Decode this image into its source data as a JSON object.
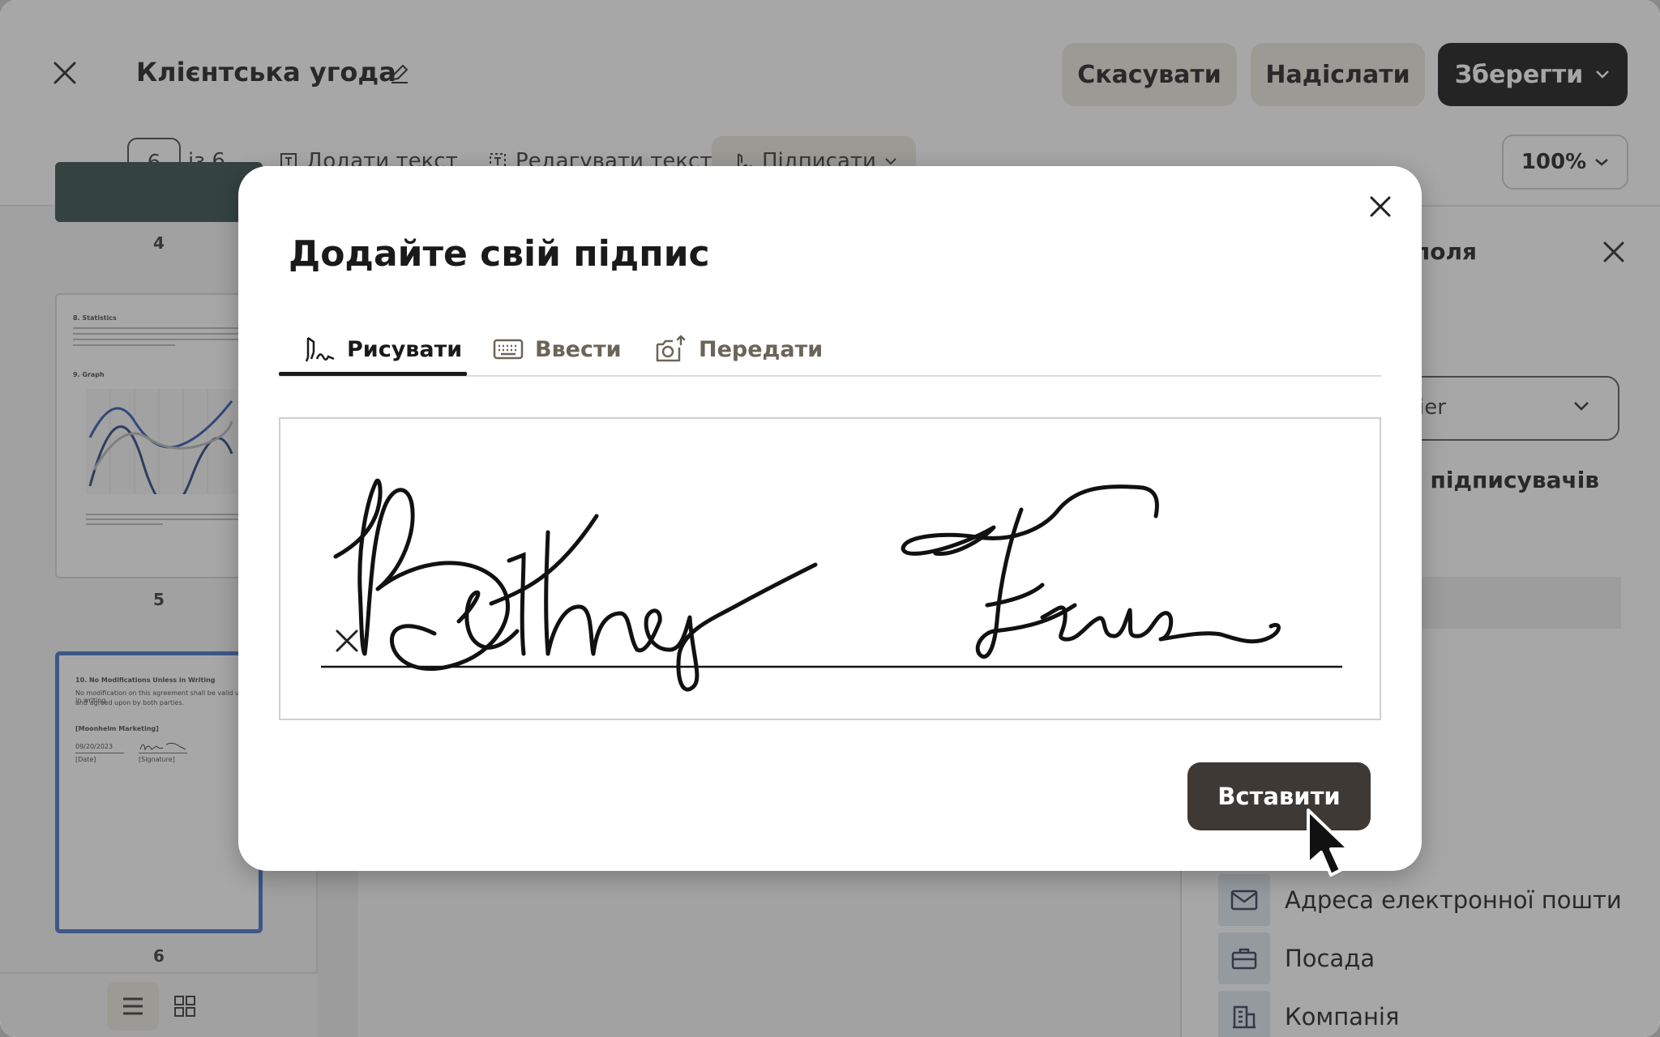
{
  "header": {
    "doc_title": "Клієнтська угода",
    "cancel_label": "Скасувати",
    "send_label": "Надіслати",
    "save_label": "Зберегти"
  },
  "toolbar": {
    "page_current": "6",
    "page_of": "із 6",
    "add_text_label": "Додати текст",
    "edit_text_label": "Редагувати текст",
    "sign_label": "Підписати",
    "zoom_label": "100%"
  },
  "sidebar": {
    "thumbnails": [
      {
        "label": "4"
      },
      {
        "label": "5",
        "line1": "8. Statistics",
        "line2": "9. Graph"
      },
      {
        "label": "6",
        "line1": "10. No Modifications Unless in Writing",
        "line2": "No modification on this agreement shall be valid unless in writing",
        "line3": "and agreed upon by both parties.",
        "line4": "[Moonhelm Marketing]",
        "date": "09/20/2023",
        "date_label": "[Date]",
        "sig_label": "[Signature]"
      }
    ]
  },
  "right_panel": {
    "title": "та поля",
    "select_value": "ier",
    "add_signers": "ати підписувачів",
    "fields": [
      {
        "label": "Адреса електронної пошти",
        "icon": "envelope-icon"
      },
      {
        "label": "Посада",
        "icon": "briefcase-icon"
      },
      {
        "label": "Компанія",
        "icon": "building-icon"
      }
    ]
  },
  "modal": {
    "title": "Додайте свій підпис",
    "tabs": [
      {
        "label": "Рисувати",
        "icon": "pen-signature-icon",
        "active": true
      },
      {
        "label": "Ввести",
        "icon": "keyboard-icon",
        "active": false
      },
      {
        "label": "Передати",
        "icon": "camera-upload-icon",
        "active": false
      }
    ],
    "insert_label": "Вставити"
  },
  "colors": {
    "primary_dark": "#111111",
    "insert_button": "#3e3935",
    "secondary_button": "#ece7df",
    "selected_thumb_border": "#3f6fc5"
  }
}
